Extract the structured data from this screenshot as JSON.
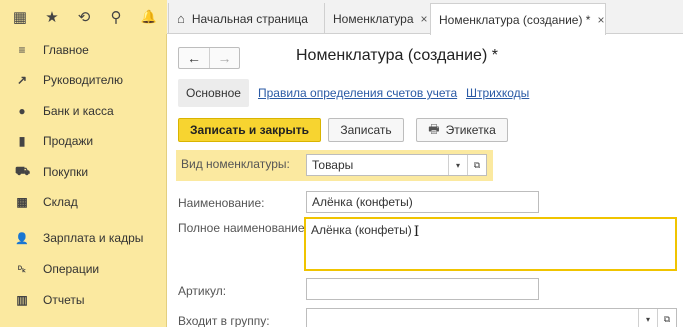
{
  "topbar": {
    "icons": [
      {
        "name": "apps-grid-icon",
        "glyph": "▦"
      },
      {
        "name": "star-icon",
        "glyph": "★"
      },
      {
        "name": "history-icon",
        "glyph": "⟲"
      },
      {
        "name": "search-icon",
        "glyph": "⚲"
      },
      {
        "name": "bell-icon",
        "glyph": "🔔"
      }
    ],
    "tabs": [
      {
        "label": "Начальная страница"
      },
      {
        "label": "Номенклатура",
        "close": "×"
      },
      {
        "label": "Номенклатура (создание) *",
        "close": "×"
      }
    ]
  },
  "sidebar": {
    "items": [
      {
        "label": "Главное",
        "icon": "menu-lines-icon",
        "glyph": "≡"
      },
      {
        "label": "Руководителю",
        "icon": "trend-icon",
        "glyph": "↗"
      },
      {
        "label": "Банк и касса",
        "icon": "coin-icon",
        "glyph": "●"
      },
      {
        "label": "Продажи",
        "icon": "bag-icon",
        "glyph": "▮"
      },
      {
        "label": "Покупки",
        "icon": "cart-icon",
        "glyph": "⛟"
      },
      {
        "label": "Склад",
        "icon": "warehouse-icon",
        "glyph": "▦"
      },
      {
        "label": "Зарплата и кадры",
        "icon": "person-icon",
        "glyph": "👤"
      },
      {
        "label": "Операции",
        "icon": "debit-credit-icon",
        "glyph": "ᴰₖ"
      },
      {
        "label": "Отчеты",
        "icon": "bar-chart-icon",
        "glyph": "▥"
      }
    ]
  },
  "form": {
    "nav_back": "←",
    "nav_forward": "→",
    "title": "Номенклатура (создание) *",
    "subtabs": [
      "Основное",
      "Правила определения счетов учета",
      "Штрихкоды"
    ],
    "buttons": {
      "save_close": "Записать и закрыть",
      "save": "Записать",
      "label_btn": "Этикетка",
      "print_glyph": "🖶"
    },
    "fields": {
      "kind_label": "Вид номенклатуры:",
      "kind_value": "Товары",
      "name_label": "Наименование:",
      "name_value": "Алёнка (конфеты)",
      "fullname_label": "Полное наименование:",
      "fullname_value": "Алёнка (конфеты)",
      "article_label": "Артикул:",
      "article_value": "",
      "group_label": "Входит в группу:",
      "group_value": ""
    },
    "dropdown_glyph": "▾",
    "open_glyph": "⧉"
  },
  "colors": {
    "sidebar_bg": "#fbe9a0",
    "accent_yellow": "#f7d430",
    "link_blue": "#2a5aa5"
  }
}
